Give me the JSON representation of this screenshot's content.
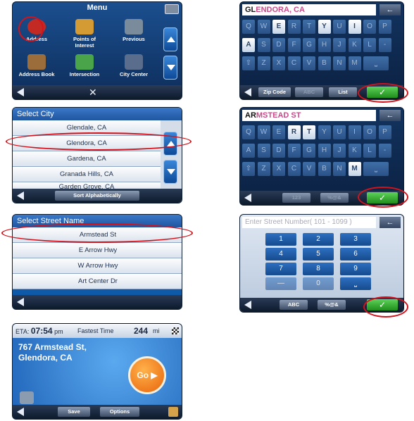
{
  "menu": {
    "title": "Menu",
    "items": [
      {
        "label": "Address",
        "icon": "address-house-icon",
        "color": "#c42a24"
      },
      {
        "label": "Points of Interest",
        "icon": "poi-map-icon",
        "color": "#d49a34"
      },
      {
        "label": "Previous",
        "icon": "previous-car-icon",
        "color": "#7a8b9c"
      },
      {
        "label": "Address Book",
        "icon": "address-book-icon",
        "color": "#9a6d3a"
      },
      {
        "label": "Intersection",
        "icon": "intersection-sign-icon",
        "color": "#4aa54a"
      },
      {
        "label": "City Center",
        "icon": "city-center-icon",
        "color": "#5a6d8c"
      }
    ]
  },
  "select_city": {
    "title": "Select City",
    "items": [
      "Glendale, CA",
      "Glendora, CA",
      "Gardena, CA",
      "Granada Hills, CA",
      "Garden Grove, CA"
    ],
    "sort_label": "Sort Alphabetically"
  },
  "select_street": {
    "title": "Select Street Name",
    "items": [
      "Armstead St",
      "E Arrow Hwy",
      "W Arrow Hwy",
      "Art Center Dr"
    ]
  },
  "route": {
    "eta_label": "ETA:",
    "eta_time": "07:54",
    "eta_ampm": "pm",
    "mode": "Fastest Time",
    "distance": "244",
    "distance_unit": "mi",
    "address_line1": "767 Armstead St,",
    "address_line2": "Glendora, CA",
    "go_label": "Go",
    "save_label": "Save",
    "options_label": "Options"
  },
  "kb_city": {
    "typed": "GL",
    "rest": "ENDORA, CA",
    "row1": [
      "Q",
      "W",
      "E",
      "R",
      "T",
      "Y",
      "U",
      "I",
      "O",
      "P"
    ],
    "row2": [
      "A",
      "S",
      "D",
      "F",
      "G",
      "H",
      "J",
      "K",
      "L",
      "-"
    ],
    "row3": [
      "⇧",
      "Z",
      "X",
      "C",
      "V",
      "B",
      "N",
      "M",
      "⎵"
    ],
    "zip_label": "Zip Code",
    "abc_label": "ABC",
    "list_label": "List",
    "check": "✓",
    "backspace": "←"
  },
  "kb_street": {
    "typed": "AR",
    "rest": "MSTEAD ST",
    "num_label": "123",
    "sym_label": "%@&",
    "check": "✓",
    "backspace": "←"
  },
  "numpad": {
    "placeholder": "Enter Street Number( 101 - 1099 )",
    "keys": [
      "1",
      "2",
      "3",
      "4",
      "5",
      "6",
      "7",
      "8",
      "9",
      "—",
      "0",
      "⎵"
    ],
    "abc_label": "ABC",
    "sym_label": "%@&",
    "check": "✓",
    "backspace": "←"
  }
}
